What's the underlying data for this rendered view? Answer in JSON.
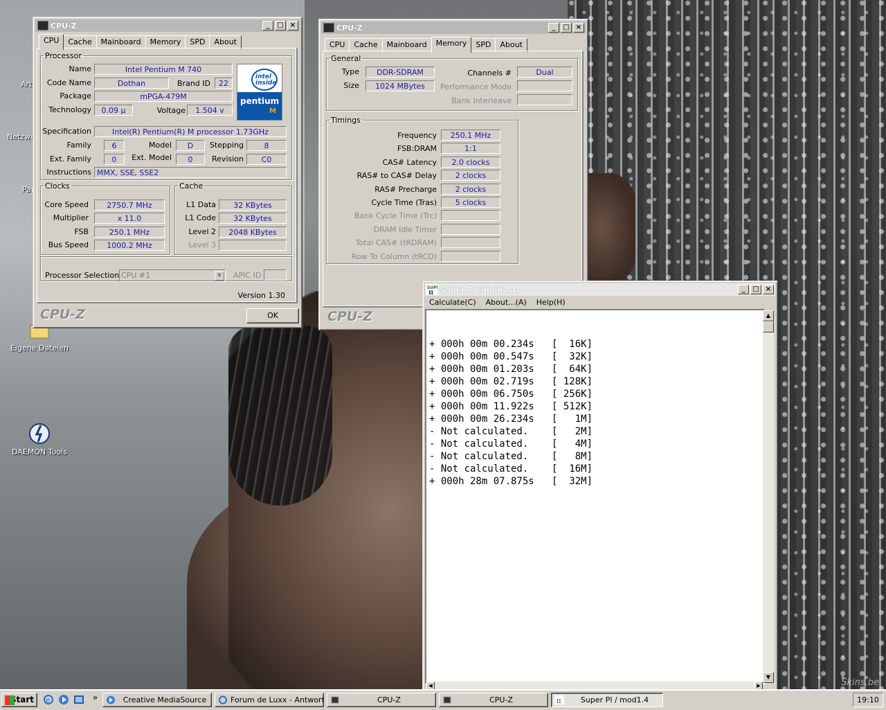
{
  "desktop": {
    "icons": [
      {
        "label": "Eigene Dateien"
      },
      {
        "label": "DAEMON Tools"
      }
    ],
    "partial_labels": [
      "Arb",
      "Netzwe",
      "Pap"
    ],
    "watermark": "Skins.be"
  },
  "cpuz_cpu": {
    "title": "CPU-Z",
    "tabs": [
      "CPU",
      "Cache",
      "Mainboard",
      "Memory",
      "SPD",
      "About"
    ],
    "active_tab": "CPU",
    "processor_group": "Processor",
    "name_label": "Name",
    "name": "Intel Pentium M 740",
    "codename_label": "Code Name",
    "codename": "Dothan",
    "brandid_label": "Brand ID",
    "brandid": "22",
    "package_label": "Package",
    "package": "mPGA-479M",
    "technology_label": "Technology",
    "technology": "0.09 µ",
    "voltage_label": "Voltage",
    "voltage": "1.504 v",
    "spec_label": "Specification",
    "spec": "Intel(R) Pentium(R) M processor 1.73GHz",
    "family_label": "Family",
    "family": "6",
    "model_label": "Model",
    "model": "D",
    "stepping_label": "Stepping",
    "stepping": "8",
    "extfamily_label": "Ext. Family",
    "extfamily": "0",
    "extmodel_label": "Ext. Model",
    "extmodel": "0",
    "revision_label": "Revision",
    "revision": "C0",
    "instructions_label": "Instructions",
    "instructions": "MMX, SSE, SSE2",
    "clocks_group": "Clocks",
    "corespeed_label": "Core Speed",
    "corespeed": "2750.7 MHz",
    "multiplier_label": "Multiplier",
    "multiplier": "x 11.0",
    "fsb_label": "FSB",
    "fsb": "250.1 MHz",
    "busspeed_label": "Bus Speed",
    "busspeed": "1000.2 MHz",
    "cache_group": "Cache",
    "l1data_label": "L1 Data",
    "l1data": "32 KBytes",
    "l1code_label": "L1 Code",
    "l1code": "32 KBytes",
    "level2_label": "Level 2",
    "level2": "2048 KBytes",
    "level3_label": "Level 3",
    "procsel_label": "Processor Selection",
    "procsel": "CPU #1",
    "apicid_label": "APIC ID",
    "version": "Version 1.30",
    "logo": "CPU-Z",
    "ok": "OK",
    "badge_inside": "intel inside",
    "badge_pentium": "pentium",
    "badge_m": "M"
  },
  "cpuz_mem": {
    "title": "CPU-Z",
    "tabs": [
      "CPU",
      "Cache",
      "Mainboard",
      "Memory",
      "SPD",
      "About"
    ],
    "active_tab": "Memory",
    "general_group": "General",
    "type_label": "Type",
    "type": "DDR-SDRAM",
    "size_label": "Size",
    "size": "1024 MBytes",
    "channels_label": "Channels #",
    "channels": "Dual",
    "perfmode_label": "Performance Mode",
    "bankinter_label": "Bank Interleave",
    "timings_group": "Timings",
    "timings": [
      {
        "label": "Frequency",
        "value": "250.1 MHz",
        "dim": false
      },
      {
        "label": "FSB:DRAM",
        "value": "1:1",
        "dim": false
      },
      {
        "label": "CAS# Latency",
        "value": "2.0 clocks",
        "dim": false
      },
      {
        "label": "RAS# to CAS# Delay",
        "value": "2 clocks",
        "dim": false
      },
      {
        "label": "RAS# Precharge",
        "value": "2 clocks",
        "dim": false
      },
      {
        "label": "Cycle Time (Tras)",
        "value": "5 clocks",
        "dim": false
      },
      {
        "label": "Bank Cycle Time (Trc)",
        "value": "",
        "dim": true
      },
      {
        "label": "DRAM Idle Timer",
        "value": "",
        "dim": true
      },
      {
        "label": "Total CAS# (tRDRAM)",
        "value": "",
        "dim": true
      },
      {
        "label": "Row To Column (tRCD)",
        "value": "",
        "dim": true
      }
    ],
    "logo": "CPU-Z"
  },
  "superpi": {
    "title": "Super PI / mod1.4",
    "menu": [
      "Calculate(C)",
      "About...(A)",
      "Help(H)"
    ],
    "results": [
      "+ 000h 00m 00.234s   [  16K]",
      "+ 000h 00m 00.547s   [  32K]",
      "+ 000h 00m 01.203s   [  64K]",
      "+ 000h 00m 02.719s   [ 128K]",
      "+ 000h 00m 06.750s   [ 256K]",
      "+ 000h 00m 11.922s   [ 512K]",
      "+ 000h 00m 26.234s   [   1M]",
      "- Not calculated.    [   2M]",
      "- Not calculated.    [   4M]",
      "- Not calculated.    [   8M]",
      "- Not calculated.    [  16M]",
      "+ 000h 28m 07.875s   [  32M]"
    ]
  },
  "taskbar": {
    "start": "Start",
    "buttons": [
      "Creative MediaSource",
      "Forum de Luxx - Antwort...",
      "CPU-Z",
      "CPU-Z",
      "Super PI / mod1.4"
    ],
    "clock": "19:10",
    "chevron": "»"
  }
}
